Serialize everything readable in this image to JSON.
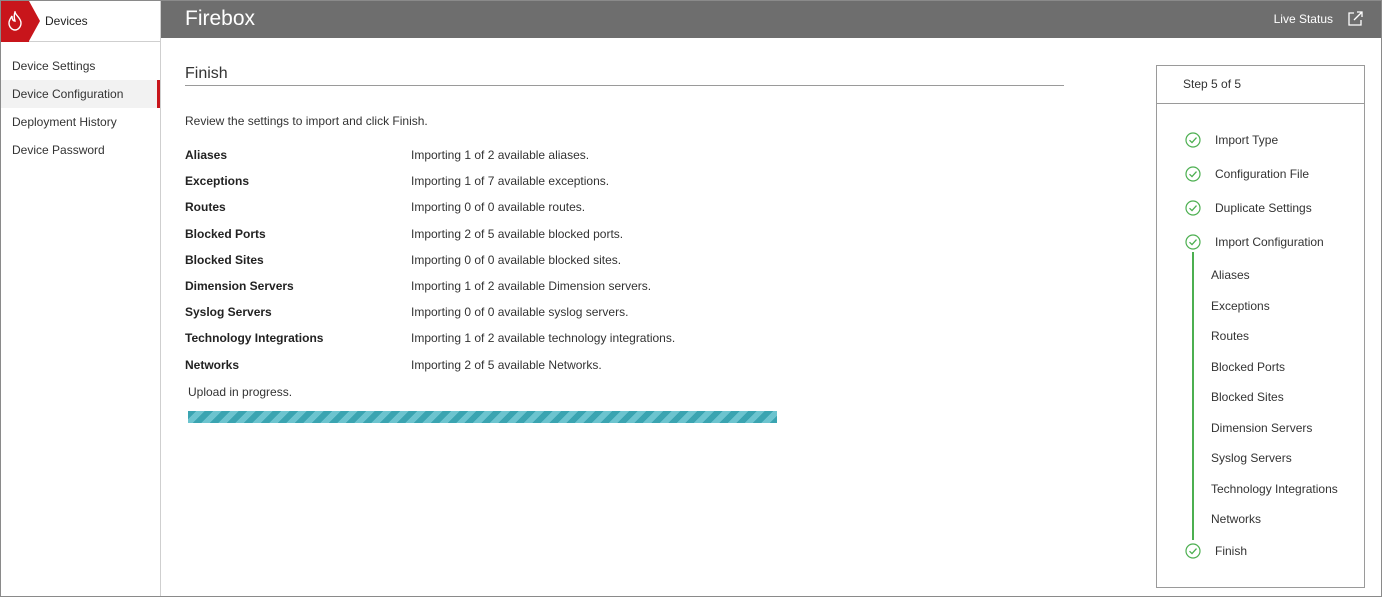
{
  "sidebar": {
    "title": "Devices",
    "items": [
      {
        "label": "Device Settings",
        "active": false
      },
      {
        "label": "Device Configuration",
        "active": true
      },
      {
        "label": "Deployment History",
        "active": false
      },
      {
        "label": "Device Password",
        "active": false
      }
    ]
  },
  "header": {
    "title": "Firebox",
    "live_status": "Live Status",
    "live_status_icon": "external-link-icon"
  },
  "main": {
    "title": "Finish",
    "intro": "Review the settings to import and click Finish.",
    "rows": [
      {
        "label": "Aliases",
        "value": "Importing 1 of 2 available aliases."
      },
      {
        "label": "Exceptions",
        "value": "Importing 1 of 7 available exceptions."
      },
      {
        "label": "Routes",
        "value": "Importing 0 of 0 available routes."
      },
      {
        "label": "Blocked Ports",
        "value": "Importing 2 of 5 available blocked ports."
      },
      {
        "label": "Blocked Sites",
        "value": "Importing 0 of 0 available blocked sites."
      },
      {
        "label": "Dimension Servers",
        "value": "Importing 1 of 2 available Dimension servers."
      },
      {
        "label": "Syslog Servers",
        "value": "Importing 0 of 0 available syslog servers."
      },
      {
        "label": "Technology Integrations",
        "value": "Importing 1 of 2 available technology integrations."
      },
      {
        "label": "Networks",
        "value": "Importing 2 of 5 available Networks."
      }
    ],
    "upload_status": "Upload in progress.",
    "progress_percent": 100
  },
  "steps": {
    "header": "Step 5 of 5",
    "items": [
      {
        "label": "Import Type",
        "done": true
      },
      {
        "label": "Configuration File",
        "done": true
      },
      {
        "label": "Duplicate Settings",
        "done": true
      },
      {
        "label": "Import Configuration",
        "done": true
      }
    ],
    "sub_items": [
      "Aliases",
      "Exceptions",
      "Routes",
      "Blocked Ports",
      "Blocked Sites",
      "Dimension Servers",
      "Syslog Servers",
      "Technology Integrations",
      "Networks"
    ],
    "final": {
      "label": "Finish",
      "done": true
    }
  },
  "colors": {
    "brand_red": "#c8151b",
    "topbar": "#6e6e6e",
    "progress": "#3aa4b1",
    "check_green": "#4caf50"
  }
}
